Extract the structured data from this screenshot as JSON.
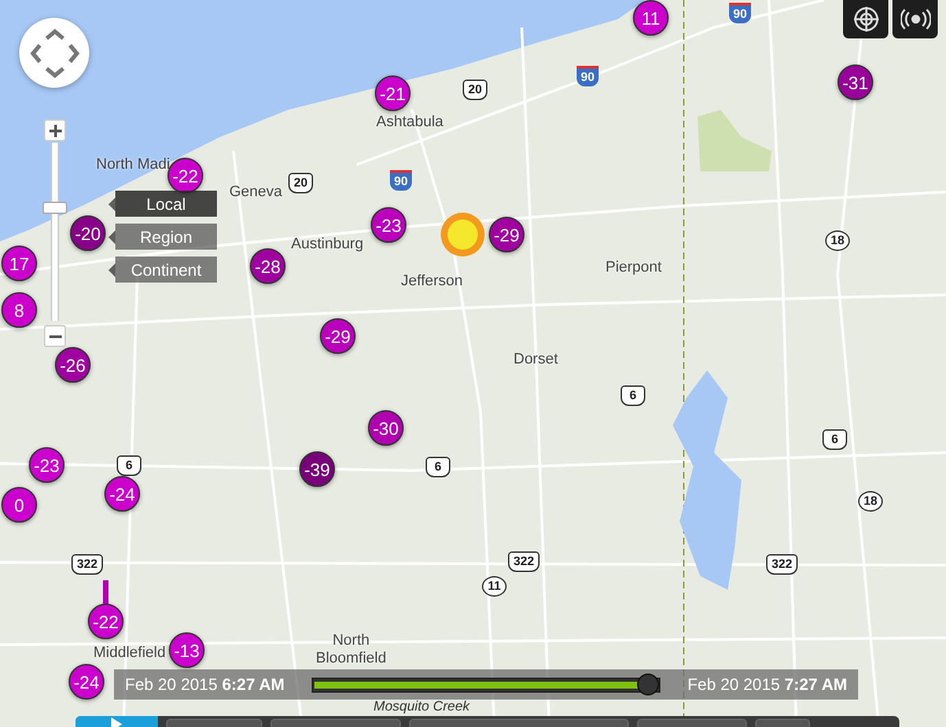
{
  "map": {
    "places": [
      {
        "name": "North Madi"
      },
      {
        "name": "Geneva"
      },
      {
        "name": "Ashtabula"
      },
      {
        "name": "Austinburg"
      },
      {
        "name": "Jefferson"
      },
      {
        "name": "Pierpont"
      },
      {
        "name": "Dorset"
      },
      {
        "name": "Middlefield"
      },
      {
        "name": "North\nBloomfield"
      }
    ],
    "shields": [
      {
        "kind": "interstate",
        "number": "90"
      },
      {
        "kind": "us",
        "number": "20"
      },
      {
        "kind": "us",
        "number": "20"
      },
      {
        "kind": "interstate",
        "number": "90"
      },
      {
        "kind": "interstate",
        "number": "90"
      },
      {
        "kind": "state",
        "number": "18"
      },
      {
        "kind": "us",
        "number": "6"
      },
      {
        "kind": "us",
        "number": "6"
      },
      {
        "kind": "us",
        "number": "6"
      },
      {
        "kind": "us",
        "number": "6"
      },
      {
        "kind": "state",
        "number": "18"
      },
      {
        "kind": "us",
        "number": "322"
      },
      {
        "kind": "us",
        "number": "322"
      },
      {
        "kind": "us",
        "number": "322"
      },
      {
        "kind": "state",
        "number": "11"
      }
    ],
    "creek": "Mosquito Creek"
  },
  "markers": [
    {
      "value": "11",
      "color": "#cc00cc",
      "kind": "plain"
    },
    {
      "value": "-31",
      "color": "#990099",
      "kind": "plain"
    },
    {
      "value": "-21",
      "color": "#cc00cc",
      "kind": "plain"
    },
    {
      "value": "-22",
      "color": "#cc00cc",
      "kind": "plain"
    },
    {
      "value": "-20",
      "color": "#880088",
      "kind": "plain"
    },
    {
      "value": "17",
      "color": "#cc00cc",
      "kind": "plain"
    },
    {
      "value": "-28",
      "color": "#a000a0",
      "kind": "plain"
    },
    {
      "value": "-23",
      "color": "#bb00bb",
      "kind": "plain"
    },
    {
      "value": "-29",
      "color": "#a000a0",
      "kind": "plain"
    },
    {
      "value": "-29",
      "color": "#bb00bb",
      "kind": "plain"
    },
    {
      "value": "-26",
      "color": "#a000a0",
      "kind": "plain"
    },
    {
      "value": "8",
      "color": "#cc00cc",
      "kind": "plain"
    },
    {
      "value": "-30",
      "color": "#b000b0",
      "kind": "plain"
    },
    {
      "value": "-39",
      "color": "#780078",
      "kind": "plain"
    },
    {
      "value": "-23",
      "color": "#cc00cc",
      "kind": "plain"
    },
    {
      "value": "-24",
      "color": "#cc00cc",
      "kind": "plain"
    },
    {
      "value": "0",
      "color": "#cc00cc",
      "kind": "plain"
    },
    {
      "value": "-22",
      "color": "#cc00cc",
      "kind": "pinned"
    },
    {
      "value": "-24",
      "color": "#cc00cc",
      "kind": "plain"
    },
    {
      "value": "-13",
      "color": "#cc00cc",
      "kind": "plain"
    }
  ],
  "nav": {
    "zoom": {
      "level": 0.64
    },
    "scales": [
      {
        "label": "Local",
        "selected": true
      },
      {
        "label": "Region",
        "selected": false
      },
      {
        "label": "Continent",
        "selected": false
      }
    ]
  },
  "timeline": {
    "start": "Feb 20 2015 **6:27 AM**",
    "end": "Feb 20 2015 **7:27 AM**",
    "level": 0.97
  }
}
